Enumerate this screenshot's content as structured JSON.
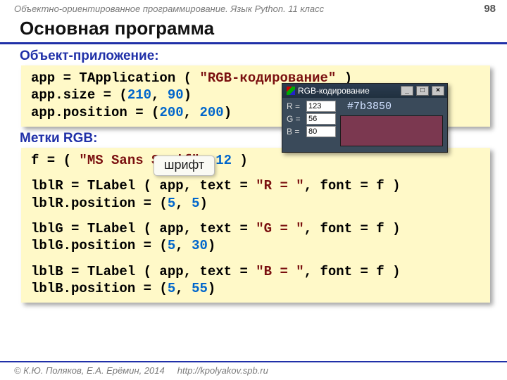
{
  "header": {
    "course": "Объектно-ориентированное программирование. Язык Python. 11 класс",
    "page": "98"
  },
  "title": "Основная программа",
  "section1": {
    "label": "Объект-приложение:"
  },
  "code1": {
    "l1a": "app = TApplication ( ",
    "l1s": "\"RGB-кодирование\"",
    "l1b": " )",
    "l2a": "app.size = (",
    "l2n1": "210",
    "l2c": ", ",
    "l2n2": "90",
    "l2b": ")",
    "l3a": "app.position = (",
    "l3n1": "200",
    "l3c": ", ",
    "l3n2": "200",
    "l3b": ")"
  },
  "section2": {
    "label": "Метки RGB:"
  },
  "tooltip": "шрифт",
  "code2": {
    "f1a": "f = ( ",
    "f1s": "\"MS Sans Serif\"",
    "f1c": ", ",
    "f1n": "12",
    "f1b": " )",
    "r1a": "lblR = TLabel ( app, text = ",
    "r1s": "\"R = \"",
    "r1b": ", font = f )",
    "r2a": "lblR.position = (",
    "r2n1": "5",
    "r2c": ", ",
    "r2n2": "5",
    "r2b": ")",
    "g1a": "lblG = TLabel ( app, text = ",
    "g1s": "\"G = \"",
    "g1b": ", font = f )",
    "g2a": "lblG.position = (",
    "g2n1": "5",
    "g2c": ", ",
    "g2n2": "30",
    "g2b": ")",
    "b1a": "lblB = TLabel ( app, text = ",
    "b1s": "\"B = \"",
    "b1b": ", font = f )",
    "b2a": "lblB.position = (",
    "b2n1": "5",
    "b2c": ", ",
    "b2n2": "55",
    "b2b": ")"
  },
  "miniwin": {
    "title": "RGB-кодирование",
    "min": "_",
    "max": "□",
    "close": "×",
    "rLabel": "R =",
    "rVal": "123",
    "gLabel": "G =",
    "gVal": "56",
    "bLabel": "B =",
    "bVal": "80",
    "hex": "#7b3850"
  },
  "footer": {
    "copyright": "© К.Ю. Поляков, Е.А. Ерёмин, 2014",
    "url": "http://kpolyakov.spb.ru"
  }
}
